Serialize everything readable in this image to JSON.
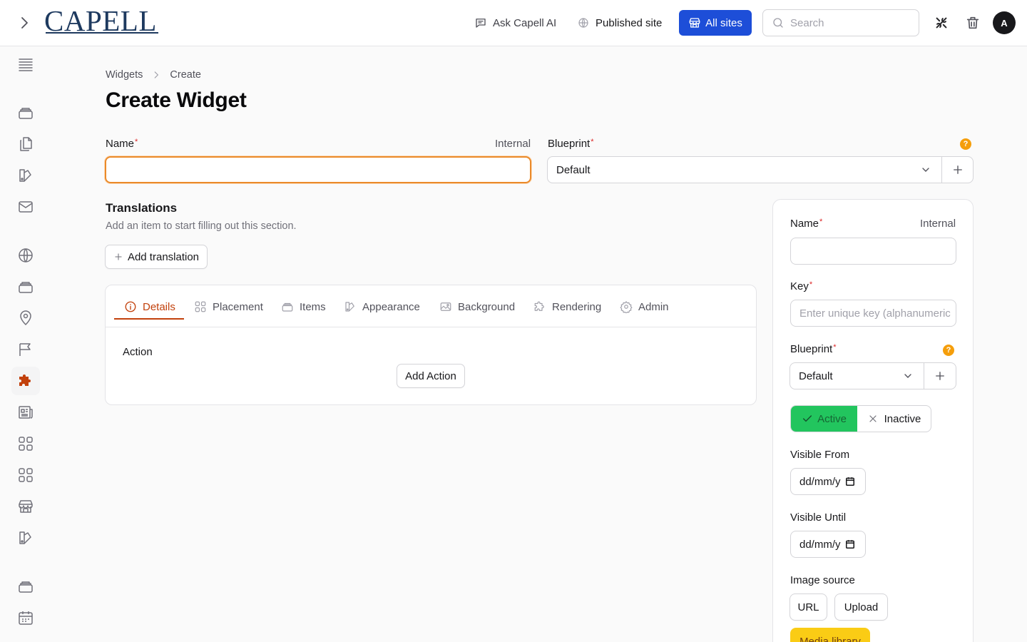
{
  "topbar": {
    "logo_text": "CAPELL",
    "ask_ai_label": "Ask Capell AI",
    "published_site_label": "Published site",
    "all_sites_label": "All sites",
    "search_placeholder": "Search",
    "avatar_initial": "A"
  },
  "breadcrumb": {
    "parent": "Widgets",
    "current": "Create"
  },
  "page": {
    "title": "Create Widget"
  },
  "form": {
    "name_label": "Name",
    "name_hint": "Internal",
    "blueprint_label": "Blueprint",
    "blueprint_value": "Default",
    "help_symbol": "?",
    "required_mark": "*"
  },
  "translations": {
    "title": "Translations",
    "description": "Add an item to start filling out this section.",
    "add_label": "Add translation"
  },
  "tabs": [
    {
      "label": "Details",
      "icon": "info-circle-icon",
      "active": true
    },
    {
      "label": "Placement",
      "icon": "grid-icon",
      "active": false
    },
    {
      "label": "Items",
      "icon": "stack-icon",
      "active": false
    },
    {
      "label": "Appearance",
      "icon": "swatch-icon",
      "active": false
    },
    {
      "label": "Background",
      "icon": "image-icon",
      "active": false
    },
    {
      "label": "Rendering",
      "icon": "puzzle-icon",
      "active": false
    },
    {
      "label": "Admin",
      "icon": "gear-icon",
      "active": false
    }
  ],
  "details": {
    "action_label": "Action",
    "add_action_label": "Add Action"
  },
  "side_panel": {
    "name_label": "Name",
    "name_hint": "Internal",
    "key_label": "Key",
    "key_placeholder": "Enter unique key (alphanumeric",
    "blueprint_label": "Blueprint",
    "blueprint_value": "Default",
    "active_label": "Active",
    "inactive_label": "Inactive",
    "visible_from_label": "Visible From",
    "visible_from_value": "dd/mm/y",
    "visible_until_label": "Visible Until",
    "visible_until_value": "dd/mm/y",
    "image_source_label": "Image source",
    "url_label": "URL",
    "upload_label": "Upload",
    "media_library_label": "Media library"
  },
  "sidebar_icons": [
    "list-icon",
    "stack-icon",
    "documents-icon",
    "swatch-icon",
    "mail-icon",
    "globe-icon",
    "stack-icon",
    "map-pin-icon",
    "flag-icon",
    "puzzle-icon",
    "newspaper-icon",
    "grid-icon",
    "grid-icon",
    "storefront-icon",
    "swatch-icon",
    "stack-icon",
    "calendar-icon"
  ],
  "colors": {
    "accent": "#c2410c",
    "primary": "#1d4ed8",
    "success": "#22c55e",
    "warning": "#f59e0b",
    "media": "#facc15"
  }
}
